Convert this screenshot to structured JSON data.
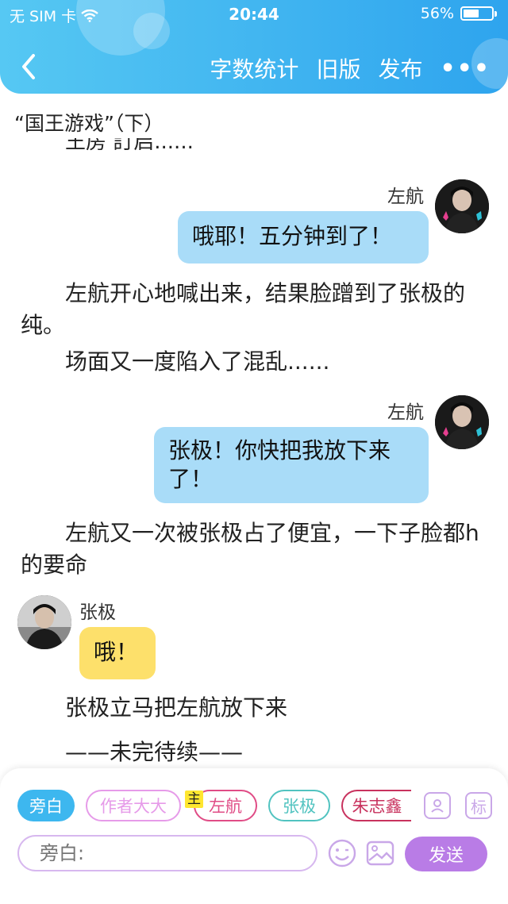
{
  "status_bar": {
    "carrier": "无 SIM 卡",
    "time": "20:44",
    "battery_text": "56%",
    "battery_level": 0.56
  },
  "nav": {
    "back_icon": "chevron-left-icon",
    "word_count": "字数统计",
    "old_version": "旧版",
    "publish": "发布",
    "more": "•••"
  },
  "story": {
    "title": "“国王游戏”（下）",
    "clipped_line": "王房 訂启......"
  },
  "messages": [
    {
      "type": "chat",
      "speaker": "左航",
      "side": "right",
      "text": "哦耶！五分钟到了！"
    },
    {
      "type": "narration",
      "text": "左航开心地喊出来，结果脸蹭到了张极的纯。"
    },
    {
      "type": "narration",
      "text": "场面又一度陷入了混乱......"
    },
    {
      "type": "chat",
      "speaker": "左航",
      "side": "right",
      "text": "张极！你快把我放下来了！"
    },
    {
      "type": "narration",
      "text": "左航又一次被张极占了便宜，一下子脸都h的要命"
    },
    {
      "type": "chat",
      "speaker": "张极",
      "side": "left",
      "text": "哦！"
    },
    {
      "type": "narration",
      "text": "张极立马把左航放下来"
    },
    {
      "type": "narration",
      "text": "——未完待续——"
    }
  ],
  "roles": [
    {
      "label": "旁白",
      "selected": true,
      "color": "#3db7ef"
    },
    {
      "label": "作者大大",
      "color": "#e69be9"
    },
    {
      "label": "左航",
      "color": "#e04c86",
      "tag": "主"
    },
    {
      "label": "张极",
      "color": "#51c3c0"
    },
    {
      "label": "朱志鑫",
      "color": "#c8325e"
    }
  ],
  "panel": {
    "role_manage_icon": "person-card-icon",
    "tag_label": "标",
    "input_placeholder": "旁白:",
    "emoji_icon": "smiley-icon",
    "image_icon": "image-icon",
    "send_label": "发送"
  },
  "colors": {
    "header_start": "#56c8f3",
    "header_end": "#2ea4ee",
    "bubble_blue": "#a9dcf8",
    "bubble_yellow": "#fde06b",
    "send": "#b97ce6"
  }
}
